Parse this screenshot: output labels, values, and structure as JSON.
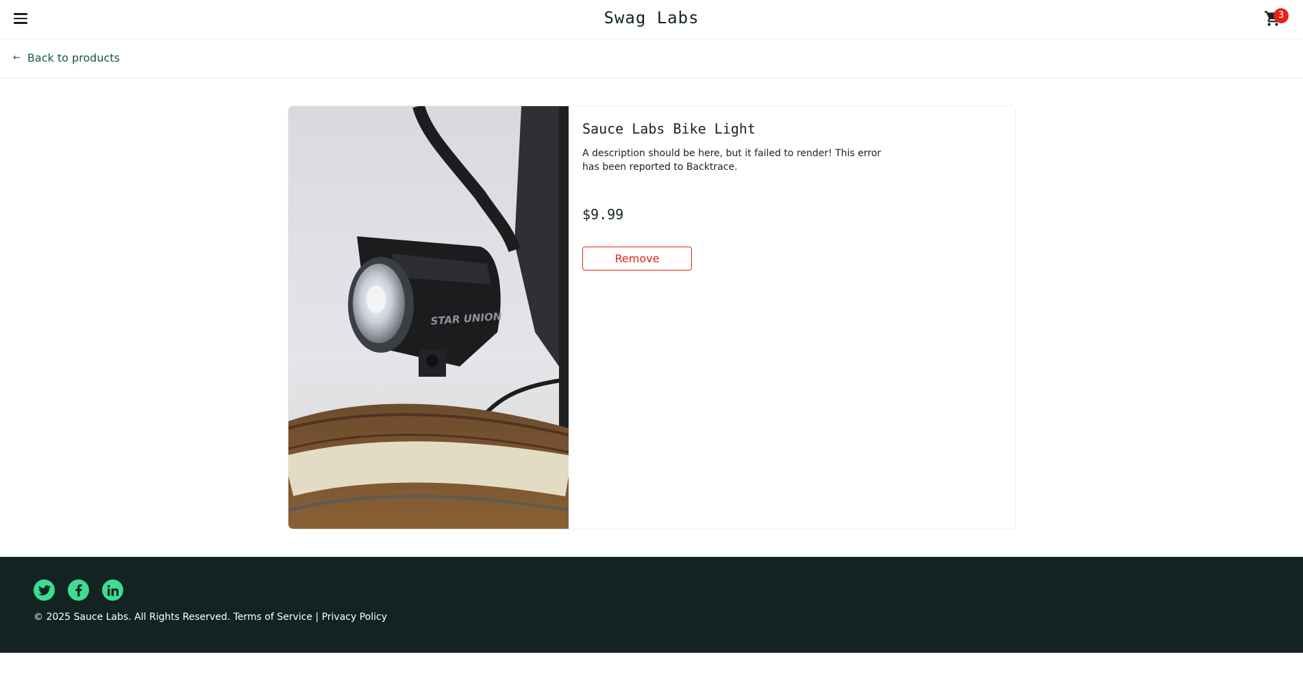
{
  "header": {
    "app_title": "Swag Labs",
    "cart_count": "3",
    "menu_icon": "hamburger-menu-icon",
    "cart_icon": "shopping-cart-icon"
  },
  "sub_header": {
    "back_label": "Back to products",
    "back_icon": "arrow-left-icon"
  },
  "product": {
    "name": "Sauce Labs Bike Light",
    "description": "A description should be here, but it failed to render! This error has been reported to Backtrace.",
    "price": "$9.99",
    "remove_label": "Remove",
    "image_alt": "Sauce Labs Bike Light"
  },
  "footer": {
    "socials": [
      "twitter-icon",
      "facebook-icon",
      "linkedin-icon"
    ],
    "copyright": "© 2025 Sauce Labs. All Rights Reserved. ",
    "terms_label": "Terms of Service",
    "separator": " | ",
    "privacy_label": "Privacy Policy"
  },
  "colors": {
    "accent": "#3ddc91",
    "dark": "#132322",
    "danger": "#e2231a",
    "link_green": "#18583a"
  }
}
